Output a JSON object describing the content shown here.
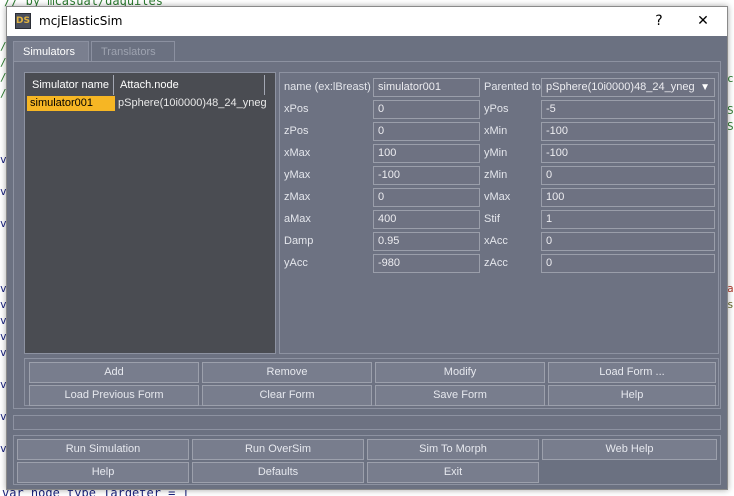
{
  "background": {
    "top_comment": "// by mcasual/daquiles",
    "left_marks": [
      "/",
      "/",
      "/",
      "/",
      "v",
      "v",
      "v",
      "v",
      "v",
      "v",
      "v",
      "v",
      "v",
      "v",
      "v"
    ],
    "right_marks": [
      "c",
      "S",
      "S",
      "a",
      "s"
    ],
    "bottom_code": "var node type Targeter = ["
  },
  "window": {
    "app_icon": "DS",
    "title": "mcjElasticSim",
    "help_glyph": "?",
    "close_glyph": "✕"
  },
  "tabs": [
    {
      "label": "Simulators",
      "active": true
    },
    {
      "label": "Translators",
      "active": false
    }
  ],
  "list": {
    "columns": [
      "Simulator name",
      "Attach.node"
    ],
    "rows": [
      {
        "name": "simulator001",
        "node": "pSphere(10i0000)48_24_yneg",
        "selected": true
      }
    ]
  },
  "form": {
    "name_label": "name (ex:lBreast)",
    "name_value": "simulator001",
    "parented_label": "Parented to",
    "parented_value": "pSphere(10i0000)48_24_yneg",
    "dropdown_arrow": "▼",
    "fields": [
      {
        "l1": "xPos",
        "v1": "0",
        "l2": "yPos",
        "v2": "-5"
      },
      {
        "l1": "zPos",
        "v1": "0",
        "l2": "xMin",
        "v2": "-100"
      },
      {
        "l1": "xMax",
        "v1": "100",
        "l2": "yMin",
        "v2": "-100"
      },
      {
        "l1": "yMax",
        "v1": "-100",
        "l2": "zMin",
        "v2": "0"
      },
      {
        "l1": "zMax",
        "v1": "0",
        "l2": "vMax",
        "v2": "100"
      },
      {
        "l1": "aMax",
        "v1": "400",
        "l2": "Stif",
        "v2": "1"
      },
      {
        "l1": "Damp",
        "v1": "0.95",
        "l2": "xAcc",
        "v2": "0"
      },
      {
        "l1": "yAcc",
        "v1": "-980",
        "l2": "zAcc",
        "v2": "0"
      }
    ]
  },
  "form_buttons": [
    "Add",
    "Remove",
    "Modify",
    "Load Form ...",
    "Load Previous Form",
    "Clear Form",
    "Save Form",
    "Help"
  ],
  "bottom_buttons": [
    "Run Simulation",
    "Run OverSim",
    "Sim To Morph",
    "Web Help",
    "Help",
    "Defaults",
    "Exit"
  ]
}
